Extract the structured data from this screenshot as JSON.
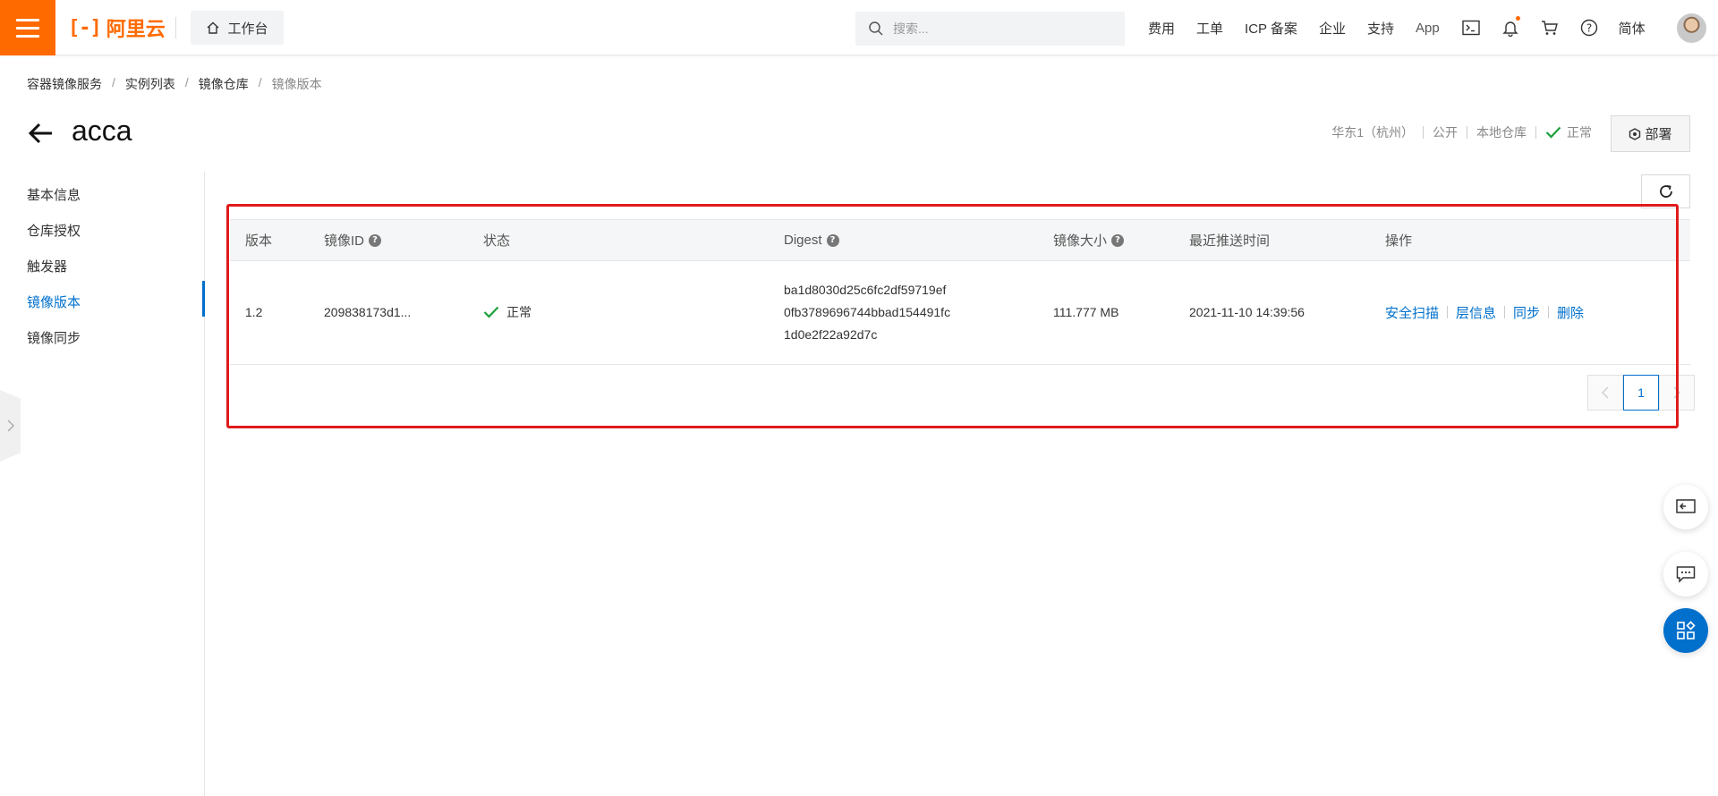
{
  "topbar": {
    "logo_mark": "[-]",
    "logo_text": "阿里云",
    "workbench": "工作台",
    "search_placeholder": "搜索...",
    "nav": [
      "费用",
      "工单",
      "ICP 备案",
      "企业",
      "支持",
      "App"
    ],
    "language": "简体",
    "icons": [
      "terminal-icon",
      "bell-icon",
      "cart-icon",
      "help-icon"
    ],
    "accent": "#ff6a00"
  },
  "breadcrumb": [
    "容器镜像服务",
    "实例列表",
    "镜像仓库",
    "镜像版本"
  ],
  "page": {
    "title": "acca",
    "region": "华东1（杭州）",
    "visibility": "公开",
    "repo_type": "本地仓库",
    "status": "正常",
    "deploy": "部署"
  },
  "sidebar": {
    "items": [
      "基本信息",
      "仓库授权",
      "触发器",
      "镜像版本",
      "镜像同步"
    ],
    "active": "镜像版本",
    "active_color": "#0070cc"
  },
  "table": {
    "headers": [
      "版本",
      "镜像ID",
      "状态",
      "Digest",
      "镜像大小",
      "最近推送时间",
      "操作"
    ],
    "rows": [
      {
        "version": "1.2",
        "image_id": "209838173d1...",
        "status": "正常",
        "digest": [
          "ba1d8030d25c6fc2df59719ef",
          "0fb3789696744bbad154491fc",
          "1d0e2f22a92d7c"
        ],
        "size": "111.777 MB",
        "pushed": "2021-11-10 14:39:56",
        "actions": [
          "安全扫描",
          "层信息",
          "同步",
          "删除"
        ]
      }
    ]
  },
  "pagination": {
    "current": "1"
  }
}
